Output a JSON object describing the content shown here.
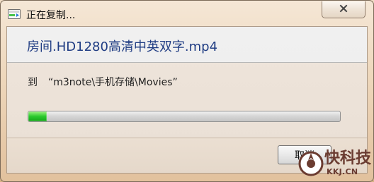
{
  "window": {
    "title": "正在复制...",
    "file_name": "房间.HD1280高清中英双字.mp4",
    "destination_label": "到",
    "destination_path": "“m3note\\手机存储\\Movies”",
    "cancel_label": "取消",
    "progress_fraction": 0.06,
    "icons": {
      "title": "copy-progress-icon",
      "close": "close-icon"
    }
  },
  "watermark": {
    "main": "快科技",
    "sub": "KKJ.CN"
  },
  "colors": {
    "accent": "#1f3c83",
    "progress": "#2bc92d",
    "window": "#efe5db"
  }
}
